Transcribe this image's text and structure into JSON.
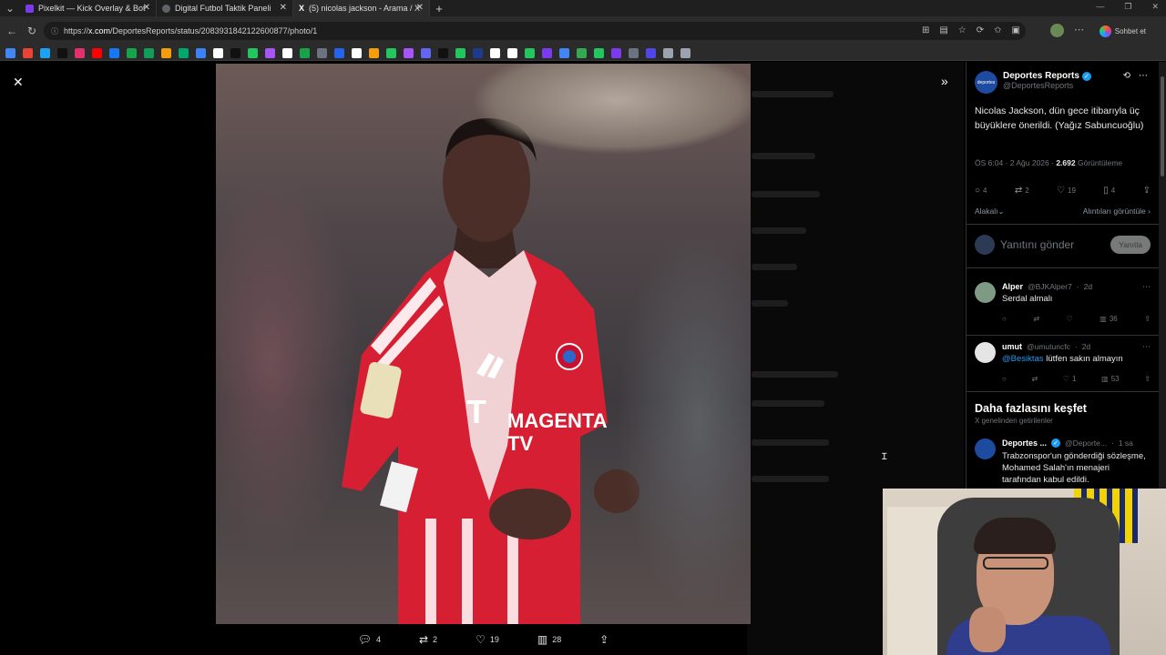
{
  "browser": {
    "tabs": [
      {
        "title": "Pixelkit — Kick Overlay & Bot",
        "favicon_color": "#7c3aed"
      },
      {
        "title": "Digital Futbol Taktik Paneli",
        "favicon_color": "#5f6368"
      },
      {
        "title": "(5) nicolas jackson - Arama / X",
        "favicon_color": "#000000"
      }
    ],
    "address": {
      "host": "x.com",
      "path": "/DeportesReports/status/2083931842122600877/photo/1",
      "prefix": "https://"
    },
    "copilot_label": "Sohbet et"
  },
  "bookmarks": [
    "#4285f4",
    "#ea4335",
    "#1da1f2",
    "#111111",
    "#e1306c",
    "#ff0000",
    "#1877f2",
    "#16a34a",
    "#0f9d58",
    "#f59e0b",
    "#00a86b",
    "#3b82f6",
    "#ffffff",
    "#111111",
    "#22c55e",
    "#a855f7",
    "#ffffff",
    "#16a34a",
    "#6b7280",
    "#2563eb",
    "#ffffff",
    "#f59e0b",
    "#22c55e",
    "#a855f7",
    "#6366f1",
    "#111111",
    "#22c55e",
    "#1e3a8a",
    "#ffffff",
    "#ffffff",
    "#22c55e",
    "#7c3aed",
    "#4285f4",
    "#34a853",
    "#22c55e",
    "#7c3aed",
    "#6b7280",
    "#4f46e5",
    "#9ca3af",
    "#9ca3af"
  ],
  "photo_actions": {
    "replies": "4",
    "retweets": "2",
    "likes": "19",
    "views": "28"
  },
  "tweet": {
    "author_name": "Deportes Reports",
    "author_handle": "@DeportesReports",
    "avatar_text": "deportes",
    "text": "Nicolas Jackson, dün gece itibarıyla üç büyüklere önerildi. (Yağız Sabuncuoğlu)",
    "time": "ÖS 6:04 · 2 Ağu 2026 ·",
    "views_count": "2.692",
    "views_label": "Görüntüleme",
    "stats": {
      "replies": "4",
      "retweets": "2",
      "likes": "19",
      "bookmarks": "4"
    },
    "sort_label": "Alakalı",
    "quotes_link": "Alıntıları görüntüle"
  },
  "reply_box": {
    "placeholder": "Yanıtını gönder",
    "button": "Yanıtla"
  },
  "comments": [
    {
      "name": "Alper",
      "handle": "@BJKAlper7",
      "age": "2d",
      "text": "Serdal almalı",
      "mention": "",
      "likes": "",
      "views": "36",
      "avatar_color": "#7e9a84"
    },
    {
      "name": "umut",
      "handle": "@umutuncfc",
      "age": "2d",
      "text": "lütfen sakın almayın",
      "mention": "@Besiktas",
      "likes": "1",
      "views": "53",
      "avatar_color": "#e5e5e5"
    }
  ],
  "explore": {
    "title": "Daha fazlasını keşfet",
    "subtitle": "X genelinden getirilenler",
    "item": {
      "name": "Deportes ...",
      "handle": "@Deporte...",
      "age": "1 sa",
      "text": "Trabzonspor'un gönderdiği sözleşme, Mohamed Salah'ın menajeri tarafından kabul edildi."
    }
  }
}
